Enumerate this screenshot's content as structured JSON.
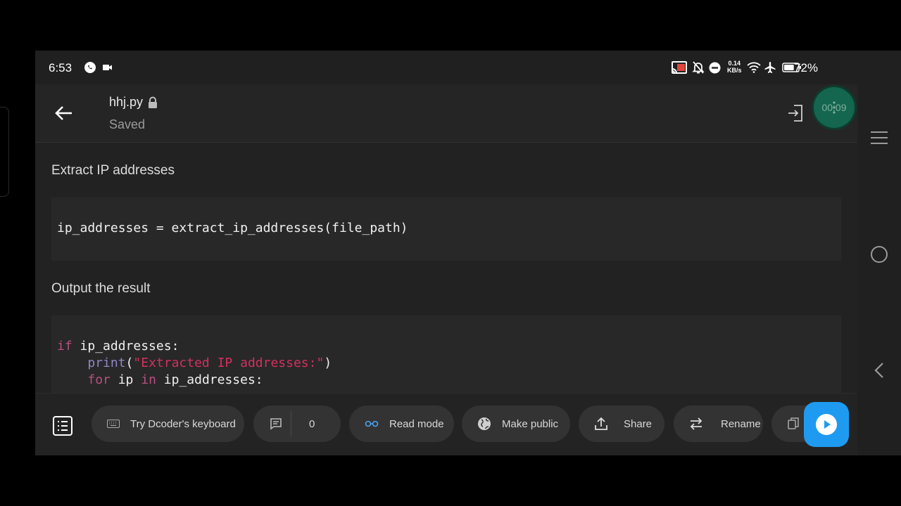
{
  "status_bar": {
    "time": "6:53",
    "net_speed": "0.14",
    "net_unit": "KB/s",
    "battery_percent": "72%",
    "battery_level": 0.72,
    "icons": [
      "whatsapp-icon",
      "video-camera-icon",
      "cast-icon",
      "mute-bell-icon",
      "do-not-disturb-icon",
      "wifi-icon",
      "airplane-icon",
      "battery-icon"
    ]
  },
  "header": {
    "file_name": "hhj.py",
    "save_status": "Saved",
    "timer": "00:09"
  },
  "notebook": {
    "cells": [
      {
        "type": "markdown",
        "text": "Extract IP addresses"
      },
      {
        "type": "code",
        "lines": [
          "ip_addresses = extract_ip_addresses(file_path)"
        ]
      },
      {
        "type": "markdown",
        "text": "Output the result"
      },
      {
        "type": "code",
        "lines": [
          "if ip_addresses:",
          "    print(\"Extracted IP addresses:\")",
          "    for ip in ip_addresses:"
        ]
      }
    ]
  },
  "toolbar": {
    "keyboard_label": "Try Dcoder's keyboard",
    "comment_count": "0",
    "read_mode_label": "Read mode",
    "make_public_label": "Make public",
    "share_label": "Share",
    "rename_label": "Rename"
  },
  "colors": {
    "accent_run": "#1e9bf0",
    "timer": "#14664e",
    "keyword": "#b84f7e",
    "string": "#d4305f",
    "builtin": "#8f86c9",
    "read_mode_icon": "#4aa3f0"
  }
}
